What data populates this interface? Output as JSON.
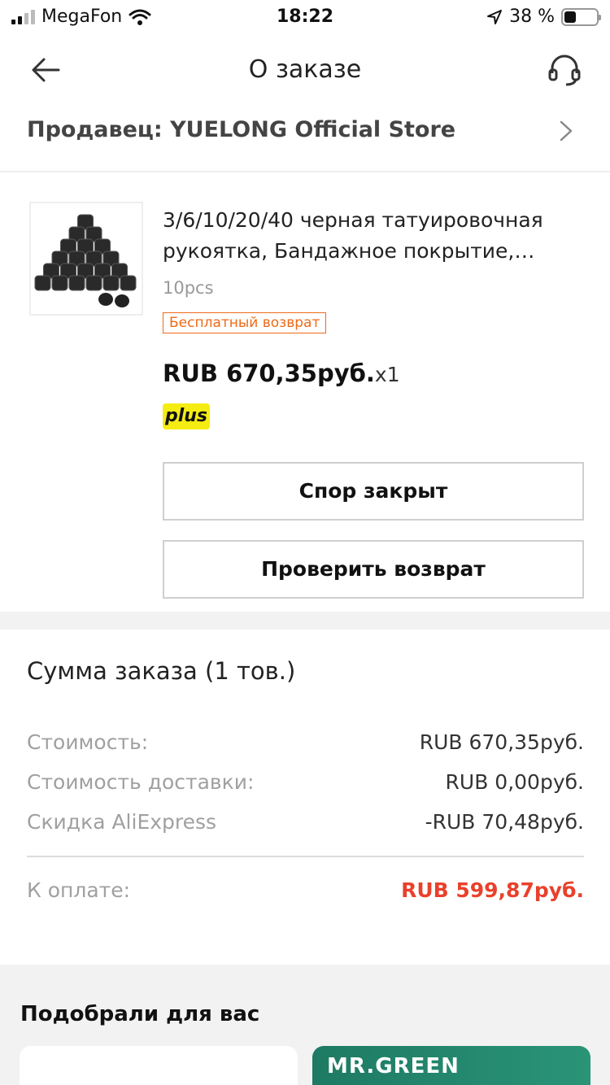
{
  "status_bar": {
    "carrier": "MegaFon",
    "time": "18:22",
    "battery_percent": "38 %",
    "battery_level": 0.38
  },
  "header": {
    "title": "О заказе",
    "back_icon": "arrow-left-icon",
    "support_icon": "headset-icon"
  },
  "seller": {
    "label": "Продавец: YUELONG Official Store"
  },
  "product": {
    "title": "3/6/10/20/40 черная татуировочная рукоятка, Бандажное покрытие, обертывание самоклеящейся бандажной лентой",
    "variant": "10pcs",
    "return_badge": "Бесплатный возврат",
    "price": "RUB 670,35руб.",
    "quantity": "x1",
    "plus_label": "plus",
    "dispute_button": "Спор закрыт",
    "return_button": "Проверить возврат"
  },
  "summary": {
    "title": "Сумма заказа (1 тов.)",
    "rows": [
      {
        "label": "Стоимость:",
        "value": "RUB 670,35руб."
      },
      {
        "label": "Стоимость доставки:",
        "value": "RUB 0,00руб."
      },
      {
        "label": "Скидка AliExpress",
        "value": "-RUB 70,48руб."
      }
    ],
    "total_label": "К оплате:",
    "total_value": "RUB 599,87руб."
  },
  "recommendations": {
    "title": "Подобрали для вас",
    "card2_brand": "MR.GREEN"
  },
  "colors": {
    "accent_red": "#e8412c",
    "badge_orange": "#ee6a18",
    "plus_yellow": "#f5ec12"
  }
}
